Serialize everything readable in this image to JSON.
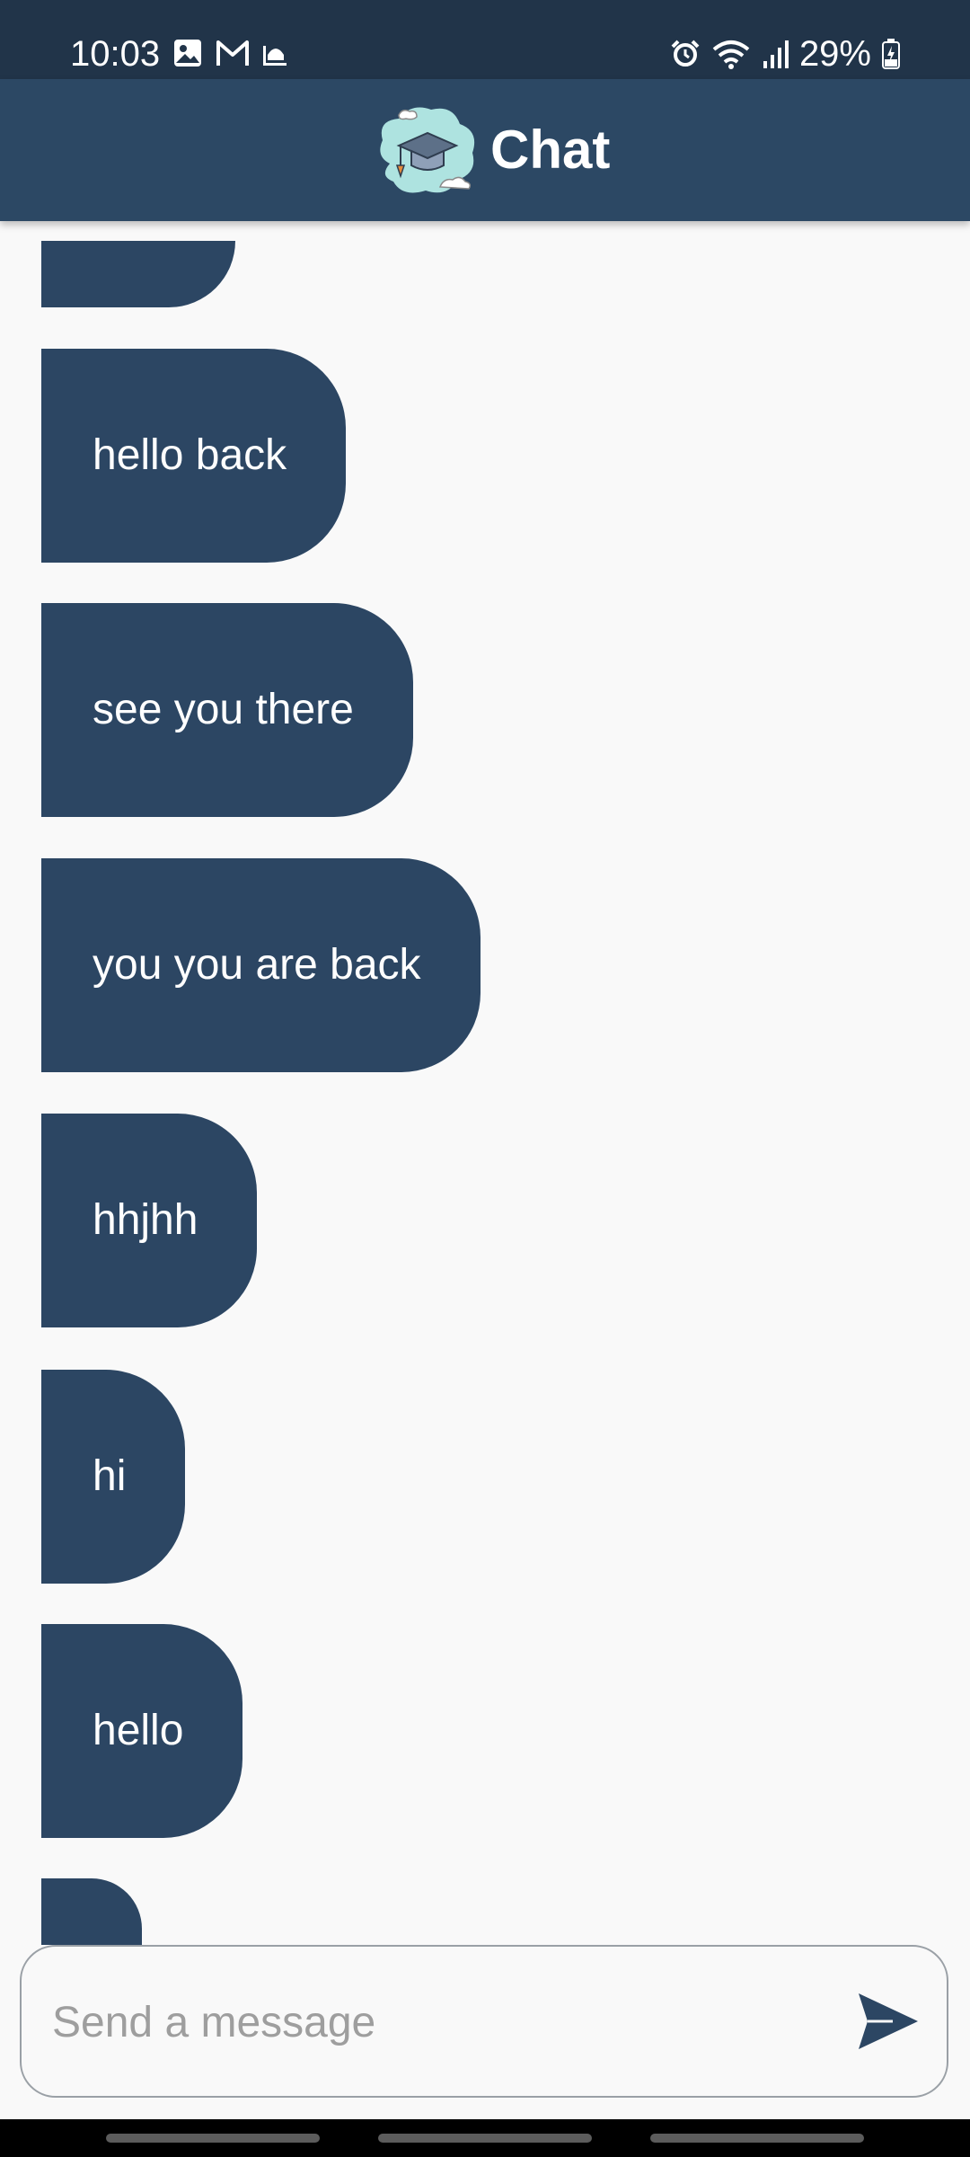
{
  "status_bar": {
    "time": "10:03",
    "left_icons": [
      "gallery-icon",
      "gmail-icon",
      "mosque-icon"
    ],
    "right_icons": [
      "alarm-icon",
      "wifi-icon",
      "signal-icon",
      "battery-icon"
    ],
    "battery": "29%"
  },
  "app_bar": {
    "title": "Chat",
    "logo": "graduation-cap-icon"
  },
  "messages": [
    {
      "text": "hello back"
    },
    {
      "text": "see you there"
    },
    {
      "text": "you you are back"
    },
    {
      "text": "hhjhh"
    },
    {
      "text": "hi"
    },
    {
      "text": "hello"
    }
  ],
  "composer": {
    "placeholder": "Send a message",
    "send_icon": "send-icon"
  },
  "colors": {
    "status_bar": "#213449",
    "app_bar": "#2c4864",
    "bubble": "#2c4663",
    "background": "#f9f9f9"
  }
}
